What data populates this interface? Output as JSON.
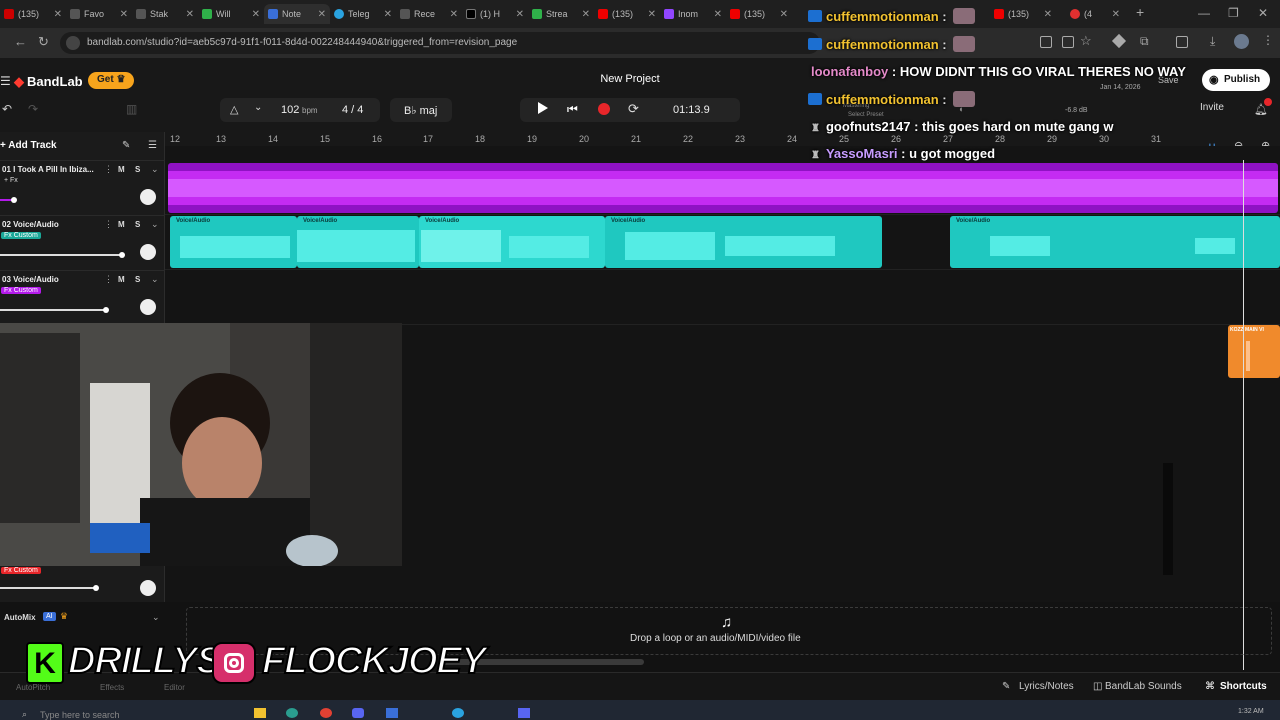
{
  "browser": {
    "tabs": [
      "(135)",
      "Favo",
      "Stak",
      "Will",
      "Note",
      "Teleg",
      "Rece",
      "(1) H",
      "Strea",
      "(135)",
      "Inom",
      "(135)",
      "",
      "(135)",
      "(4"
    ],
    "url": "bandlab.com/studio?id=aeb5c97d-91f1-f011-8d4d-002248444940&triggered_from=revision_page"
  },
  "app": {
    "logo": "BandLab",
    "get_label": "Get",
    "project_title": "New Project",
    "tempo": "102",
    "tempo_unit": "bpm",
    "time_signature": "4 / 4",
    "key": "B♭ maj",
    "time": "01:13.9",
    "publish_label": "Publish",
    "invite_label": "Invite",
    "save_label": "Save",
    "date": "Jan 14, 2026",
    "db": "-6.8 dB",
    "preset": "Select Preset",
    "mastering": "Mastering"
  },
  "tracks": {
    "add_track_label": "Add Track",
    "items": [
      {
        "name": "01  I Took A Pill In Ibiza...",
        "m": "M",
        "s": "S",
        "fx": "+ Fx"
      },
      {
        "name": "02  Voice/Audio",
        "m": "M",
        "s": "S",
        "fx": "Fx Custom"
      },
      {
        "name": "03  Voice/Audio",
        "m": "M",
        "s": "S",
        "fx": "Fx Custom"
      },
      {
        "name": "",
        "m": "",
        "s": "",
        "fx": "Fx Custom"
      }
    ],
    "automix_label": "AutoMix"
  },
  "ruler": [
    "12",
    "13",
    "14",
    "15",
    "16",
    "17",
    "18",
    "19",
    "20",
    "21",
    "22",
    "23",
    "24",
    "25",
    "26",
    "27",
    "28",
    "29",
    "30",
    "31"
  ],
  "clips": {
    "voice_label": "Voice/Audio",
    "orange_label": "KOZZ MAIN VI"
  },
  "dropzone": {
    "text": "Drop a loop or an audio/MIDI/video file"
  },
  "bottom": {
    "lyrics": "Lyrics/Notes",
    "sounds": "BandLab Sounds",
    "shortcuts": "Shortcuts",
    "autopitch": "AutoPitch",
    "effects": "Effects",
    "editor": "Editor"
  },
  "taskbar": {
    "search_placeholder": "Type here to search",
    "clock": "1:32 AM"
  },
  "chat": [
    {
      "user": "cuffemmotionman",
      "msg": ":",
      "color": "#f2c230",
      "badge": true
    },
    {
      "user": "cuffemmotionman",
      "msg": ":",
      "color": "#f2c230",
      "badge": true
    },
    {
      "user": "loonafanboy",
      "msg": ": HOW DIDNT THIS GO VIRAL THERES NO WAY",
      "color": "#e48ac9",
      "badge": false
    },
    {
      "user": "cuffemmotionman",
      "msg": ":",
      "color": "#f2c230",
      "badge": true
    },
    {
      "user": "goofnuts2147",
      "msg": ": this goes hard on mute gang w",
      "color": "#ffffff",
      "badge": false
    },
    {
      "user": "YassoMasri",
      "msg": ": u got mogged",
      "color": "#c79cff",
      "badge": false
    }
  ],
  "banner": {
    "kick": "DRILLYS",
    "instagram": "FLOCKJOEY"
  },
  "colors": {
    "accent_orange": "#f7a41c",
    "track1_purple": "#b31aea",
    "track2_teal": "#1fc8c0",
    "fx_purple": "#b31aea",
    "fx_teal": "#1aa898",
    "record_red": "#e8262a",
    "kick_green": "#53fc18"
  },
  "icons": [
    "back-icon",
    "reload-icon",
    "metronome-icon",
    "play-icon",
    "skip-back-icon",
    "record-icon",
    "loop-icon",
    "zoom-out-icon",
    "zoom-in-icon",
    "magnet-icon",
    "music-note-icon",
    "pencil-icon",
    "instagram-icon",
    "kick-icon"
  ]
}
